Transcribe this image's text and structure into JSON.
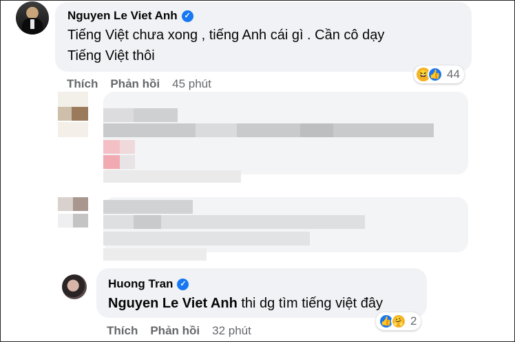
{
  "comments": [
    {
      "author": "Nguyen Le Viet Anh",
      "verified": true,
      "text_line1": "Tiếng Việt chưa xong , tiếng Anh cái gì . Cần cô dạy",
      "text_line2": "Tiếng Việt thôi",
      "reactions": [
        "haha",
        "like"
      ],
      "reaction_count": "44",
      "actions": {
        "like": "Thích",
        "reply": "Phản hồi",
        "time": "45 phút"
      }
    },
    {
      "author": "Huong Tran",
      "verified": true,
      "mention": "Nguyen Le Viet Anh",
      "text": "thi dg tìm tiếng việt đây",
      "reactions": [
        "like",
        "care"
      ],
      "reaction_count": "2",
      "actions": {
        "like": "Thích",
        "reply": "Phản hồi",
        "time": "32 phút"
      }
    }
  ],
  "icons": {
    "verified": "verified-badge-icon",
    "like": "like-reaction-icon",
    "haha": "haha-reaction-icon",
    "care": "care-reaction-icon"
  },
  "colors": {
    "bubble": "#f0f2f5",
    "accent": "#1877f2",
    "secondary_text": "#65676b"
  }
}
